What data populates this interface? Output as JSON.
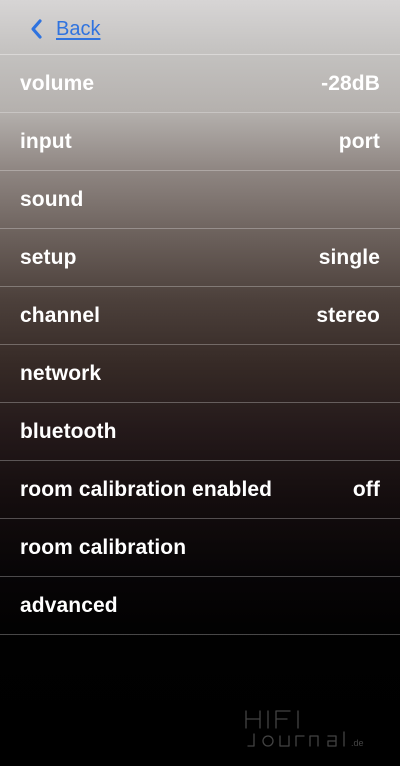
{
  "nav": {
    "back_label": "Back",
    "back_icon": "chevron-left-icon"
  },
  "menu": {
    "items": [
      {
        "label": "volume",
        "value": "-28dB"
      },
      {
        "label": "input",
        "value": "port"
      },
      {
        "label": "sound",
        "value": ""
      },
      {
        "label": "setup",
        "value": "single"
      },
      {
        "label": "channel",
        "value": "stereo"
      },
      {
        "label": "network",
        "value": ""
      },
      {
        "label": "bluetooth",
        "value": ""
      },
      {
        "label": "room calibration enabled",
        "value": "off"
      },
      {
        "label": "room calibration",
        "value": ""
      },
      {
        "label": "advanced",
        "value": ""
      }
    ]
  },
  "watermark": {
    "line1": "HIFI",
    "line2": "Journal",
    "suffix": ".de"
  },
  "colors": {
    "accent": "#2f73df",
    "text": "#ffffff",
    "divider": "#ffffff"
  }
}
